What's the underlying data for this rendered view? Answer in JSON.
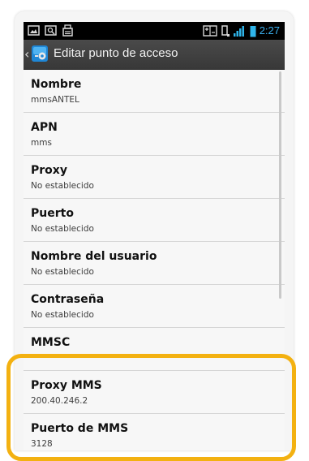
{
  "status_bar": {
    "time": "2:27",
    "left_icons": [
      "image-icon",
      "search-icon",
      "sim-lock-icon"
    ],
    "right_icons": [
      "data-transfer-icon",
      "phone-vibrate-icon",
      "signal-bars-icon",
      "battery-icon"
    ]
  },
  "action_bar": {
    "title": "Editar punto de acceso",
    "back_icon": "chevron-left-icon",
    "app_icon": "settings-app-icon"
  },
  "fields": [
    {
      "title": "Nombre",
      "value": "mmsANTEL"
    },
    {
      "title": "APN",
      "value": "mms"
    },
    {
      "title": "Proxy",
      "value": "No establecido"
    },
    {
      "title": "Puerto",
      "value": "No establecido"
    },
    {
      "title": "Nombre del usuario",
      "value": "No establecido"
    },
    {
      "title": "Contraseña",
      "value": "No establecido"
    },
    {
      "title": "MMSC",
      "value": ""
    },
    {
      "title": "Proxy MMS",
      "value": "200.40.246.2"
    },
    {
      "title": "Puerto de MMS",
      "value": "3128"
    }
  ],
  "colors": {
    "highlight": "#f3b111",
    "time_accent": "#3bb1f0",
    "signal_accent": "#2fb5ea"
  }
}
